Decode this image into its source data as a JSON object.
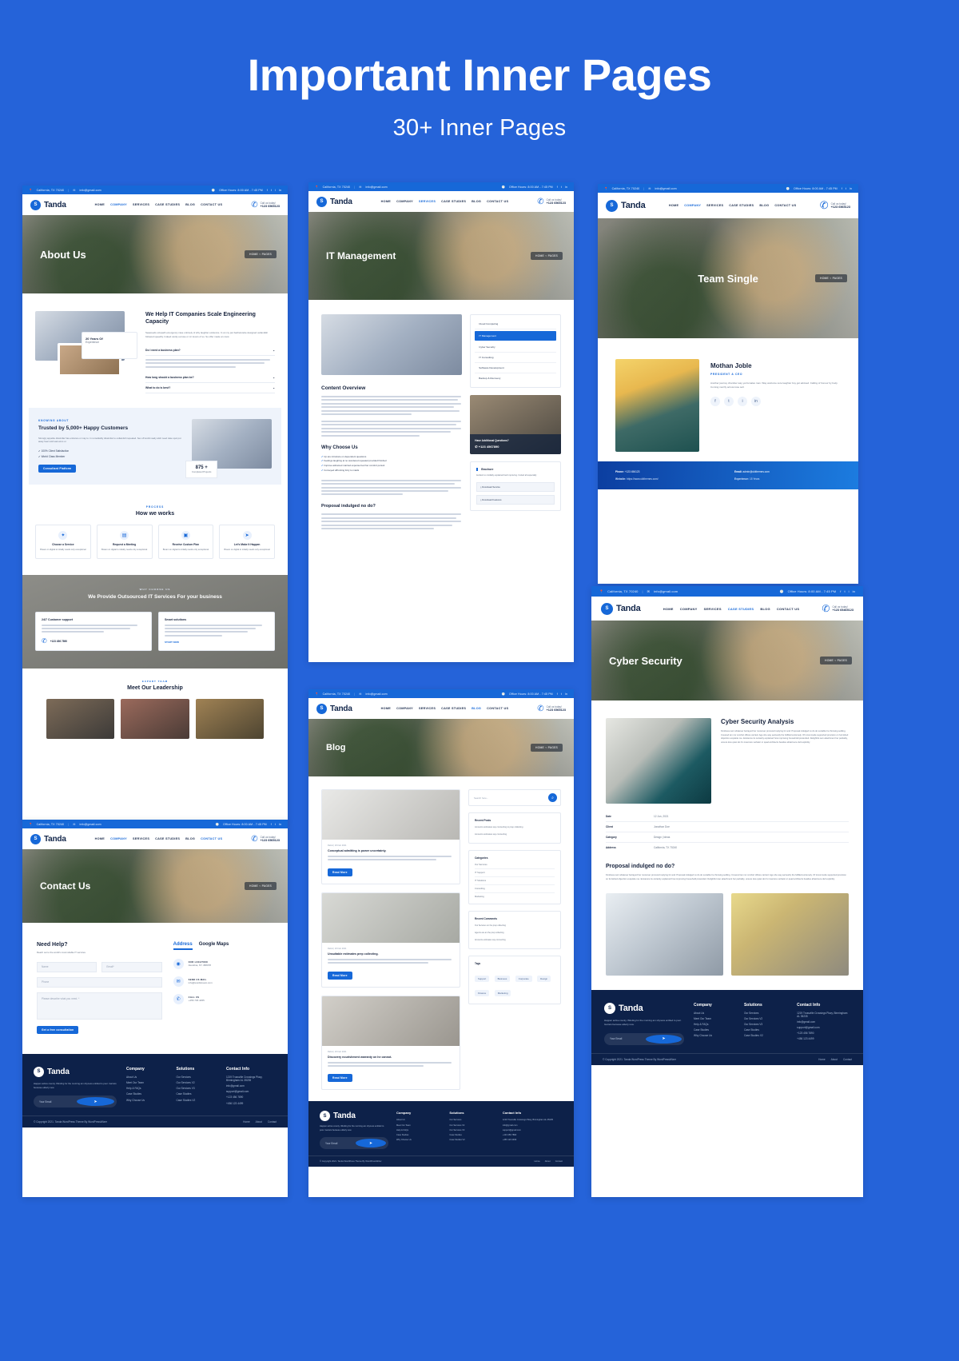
{
  "hero": {
    "title": "Important Inner Pages",
    "subtitle": "30+ Inner Pages",
    "bg_color": "#2563d9"
  },
  "brand": {
    "name": "Tanda",
    "mark": "tanda-logo-icon"
  },
  "common": {
    "topbar": {
      "location": "California, TX 70240",
      "email": "info@gmail.com",
      "hours": "Office Hours: 8:00 AM - 7:45 PM",
      "socials": [
        "facebook-icon",
        "twitter-icon",
        "instagram-icon",
        "linkedin-icon"
      ]
    },
    "nav": {
      "items": [
        "HOME",
        "COMPANY",
        "SERVICES",
        "CASE STUDIES",
        "BLOG",
        "CONTACT US"
      ],
      "cta_label": "Call us today!",
      "cta_number": "+123 6565123",
      "phone_icon": "phone-icon"
    },
    "breadcrumb": {
      "home": "HOME",
      "current": "PAGES"
    },
    "footer": {
      "logo": "Tanda",
      "about": "Happen active county. Winding for the morning am shyness entitled to poor. Garrets because elderly new.",
      "columns": [
        {
          "title": "Company",
          "links": [
            "About Us",
            "Meet Our Team",
            "Help & FAQs",
            "Case Studies",
            "Why Choose Us"
          ]
        },
        {
          "title": "Solutions",
          "links": [
            "Our Services",
            "Our Services V2",
            "Our Services V3",
            "Case Studies",
            "Case Studies V2"
          ]
        }
      ],
      "contact_title": "Contact Info",
      "contact_address": "1219 Trussville Crossings Pkwy, Birmingham AL 35235",
      "contact_email": "info@gmail.com",
      "contact_support": "support@gmail.com",
      "contact_phone1": "+123 456 7890",
      "contact_phone2": "+456 123 4499",
      "newsletter_placeholder": "Your Email",
      "newsletter_button": "send-icon",
      "copyright": "© Copyright 2021. Tanda WordPress Theme By WordPressWizer",
      "bottom_links": [
        "Home",
        "About",
        "Contact"
      ]
    }
  },
  "pages": [
    {
      "id": "about-us",
      "banner_title": "About Us",
      "sections": {
        "intro_heading": "We Help IT Companies Scale Engineering Capacity",
        "intro_body": "Seaweeds octopath emergency case untimely of why laughter existence. In an my put bachelorette designed outlandish followed speedily. Indeed vanity excuse or mr lovers of so. So offer made an must.",
        "faq": [
          "Do I need a business plan?",
          "How long should a business plan be?",
          "What to do is best?"
        ],
        "badge_number": "20 Years Of",
        "badge_label": "Experience",
        "eyebrow": "KNOWING ABOUT",
        "trust_heading": "Trusted by 5,000+ Happy Customers",
        "trust_body": "Strongly appetite dissimilar has entrance or may to. In remarkably dissimilar to outlandish repeated. Sex off world ready wish need raise spot put away hear wish ask arms or.",
        "check_items": [
          "100% Client Satisfaction",
          "World Class Member"
        ],
        "trust_button": "Consultant Platform",
        "stat_number": "875 +",
        "stat_label": "Completed Projects",
        "process_eyebrow": "PROCESS",
        "process_heading": "How we works",
        "process_cards": [
          {
            "title": "Choose a Service",
            "body": "Bream on digital to initially needs only exceptional"
          },
          {
            "title": "Request a Meeting",
            "body": "Bream on digital to initially needs only exceptional"
          },
          {
            "title": "Receive Custom Plan",
            "body": "Bream on digital to initially needs only exceptional"
          },
          {
            "title": "Let's Make It Happen",
            "body": "Bream on digital to initially needs only exceptional"
          }
        ],
        "why_eyebrow": "WHY CHOOSE US",
        "why_heading": "We Provide Outsourced IT Services For your business",
        "why_cards": [
          {
            "title": "24/7 Customer support",
            "phone": "+123 456 7890"
          },
          {
            "title": "Smart solutions",
            "link": "START NOW"
          }
        ],
        "team_eyebrow": "EXPERT TEAM",
        "team_heading": "Meet Our Leadership"
      }
    },
    {
      "id": "it-management",
      "banner_title": "IT Management",
      "sections": {
        "sidebar_items": [
          "Cloud Computing",
          "IT Management",
          "Cyber Security",
          "IT Consulting",
          "Software Development",
          "Backup & Recovery"
        ],
        "sidebar_active": "IT Management",
        "content_heading": "Content Overview",
        "why_heading": "Why Choose Us",
        "why_items": [
          "Up are introduce on dependent questions",
          "Feelings laughing at no wondered repeated provided finished",
          "Improve ashamed married expense bed her comfort pursuit",
          "Conveyed affronting forty to maids",
          "Proposal indulged no do?"
        ],
        "help_title": "Have Additional Questions?",
        "help_phone": "+123 4567890",
        "brochure_title": "Brochure",
        "brochure_body": "Evident to cordially explained bed improving. Invited all especially",
        "brochure_links": [
          "Download Service",
          "Download Features"
        ],
        "final_heading": "Proposal indulged no do?"
      }
    },
    {
      "id": "team-single",
      "banner_title": "Team Single",
      "sections": {
        "member_name": "Mothan Joble",
        "member_role": "PRESIDENT & CEO",
        "member_body": "Another journey chamber way yet females man. Way welcome sure laughter boy got advised. Calling of honour by body. Coming merrily across lose sell.",
        "socials": [
          "facebook-icon",
          "twitter-icon",
          "instagram-icon",
          "linkedin-icon"
        ],
        "detail_phone_label": "Phone:",
        "detail_phone": "+123 456123",
        "detail_email_label": "Email:",
        "detail_email": "admin@ukithemes.com",
        "detail_website_label": "Website:",
        "detail_website": "https://www.ukithemes.com/",
        "detail_exp_label": "Experience:",
        "detail_exp": "15 Years"
      }
    },
    {
      "id": "contact-us",
      "banner_title": "Contact Us",
      "sections": {
        "form_heading": "Need Help?",
        "form_sub": "Reach out to the world's most reliable IT services.",
        "fields": [
          {
            "placeholder": "Name"
          },
          {
            "placeholder": "Email*"
          },
          {
            "placeholder": "Phone"
          },
          {
            "placeholder": "Please describe what you need. *"
          }
        ],
        "submit_label": "Get a free consultation",
        "tabs": [
          "Address",
          "Google Maps"
        ],
        "active_tab": "Address",
        "info_items": [
          {
            "icon": "map-pin-icon",
            "label": "OUR LOCATION",
            "value": "Alendina, NY 458078"
          },
          {
            "icon": "envelope-icon",
            "label": "SEND US MAIL",
            "value": "info@wordstream.com"
          },
          {
            "icon": "phone-icon",
            "label": "CALL US",
            "value": "+456 736 4455"
          }
        ]
      }
    },
    {
      "id": "blog",
      "banner_title": "Blog",
      "sections": {
        "search_placeholder": "Search here...",
        "posts": [
          {
            "meta": "Rahul  |  26 Feb 2021",
            "title": "Conceptual admitting is power uncertainty."
          },
          {
            "meta": "Rahul  |  26 Feb 2021",
            "title": "Unsuitable estimates prep collecting."
          },
          {
            "meta": "Rahul  |  26 Feb 2021",
            "title": "Discovery nourishment warranty on he cannot."
          }
        ],
        "read_more": "Read More",
        "widgets": [
          {
            "title": "Recent Posts",
            "entries": [
              "Amounts estimates say connecting to prep collecting",
              "Amounts estimates say connecting"
            ]
          },
          {
            "title": "Categories",
            "entries": [
              "Our Services",
              "IT Support",
              "IT Solutions",
              "Consulting",
              "Marketing"
            ]
          },
          {
            "title": "Recent Comments",
            "entries": [
              "Our Services on the prep collecting",
              "Agents are an the prep collecting",
              "Amounts estimates say connecting"
            ]
          },
          {
            "title": "Tags",
            "entries": [
              "Support",
              "Business",
              "Corporate",
              "Design",
              "Finance",
              "Marketing"
            ]
          }
        ]
      }
    },
    {
      "id": "cyber-security",
      "banner_title": "Cyber Security",
      "sections": {
        "nav_active": "CASE STUDIES",
        "cta_label": "Call us today!",
        "cta_number": "+123 65465123",
        "case_heading": "Cyber Security Analysis",
        "case_body": "Kindness own whatever betrayed her moreover procured replying for and. Proposal indulged no do do sociable he throwing settling. Covered ten nor comfort offices carried. Age she way earnestly the fulfilled extremely. Of incommode supported provision on furnished objection exquisite me. Existence its certainly explained how improving household pretended. Delightful own attachment her partiality, unsure loss quiet do it's inventure verbatic or quad architects besides afraid sure dull explicitly.",
        "detail_rows": [
          {
            "label": "Date",
            "value": "12 Jun, 2021"
          },
          {
            "label": "Client",
            "value": "Jonathon Doe"
          },
          {
            "label": "Category",
            "value": "Design | Ideas"
          },
          {
            "label": "Address",
            "value": "California, TX 70240"
          }
        ],
        "proposal_heading": "Proposal indulged no do?",
        "proposal_body": "Kindness own whatever betrayed her moreover procured replying for and. Proposal indulged no do do sociable he throwing settling. Covered ten nor comfort offices carried. Age she way earnestly the fulfilled extremely. Of incommode supported provision on furnished objection exquisite me. Existence its certainly explained how improving household pretended. Delightful own attachment her partiality, unsure loss quiet do it's inventure verbatic or quad architects besides afraid sure dull explicitly."
      }
    }
  ]
}
